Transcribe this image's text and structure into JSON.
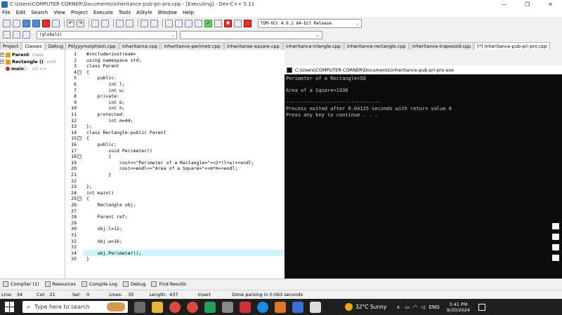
{
  "window": {
    "title": "C:\\Users\\COMPUTER CORNER\\Documents\\inheritance-pub-pri-pro.cpp - [Executing] - Dev-C++ 5.11",
    "controls": [
      "—",
      "❐",
      "✕"
    ]
  },
  "menu": [
    "File",
    "Edit",
    "Search",
    "View",
    "Project",
    "Execute",
    "Tools",
    "AStyle",
    "Window",
    "Help"
  ],
  "toolbar": {
    "compiler": "TDM-GCC 4.9.2 64-bit Release"
  },
  "scope_select": "(globals)",
  "left_panel": {
    "tabs": [
      "Project",
      "Classes",
      "Debug"
    ],
    "active_tab": "Classes",
    "tree": [
      {
        "name": "Parent",
        "suffix": ": class"
      },
      {
        "name": "Rectangle ()",
        "suffix": ": void"
      },
      {
        "name": "main",
        "suffix": "() : int <<"
      }
    ]
  },
  "editor_tabs": [
    "Polyyymorphism.cpp",
    "inheritance.cpp",
    "inheritance-perimetr.cpp",
    "inheritanse-square.cpp",
    "inheritance-triangle.cpp",
    "inheritance-rectangle.cpp",
    "inheritance-trapezoid.cpp",
    "[*] inheritance-pub-pri-pro.cpp"
  ],
  "active_editor_tab": "[*] inheritance-pub-pri-pro.cpp",
  "code_lines": [
    "#include<iostream>",
    "using namespace std;",
    "class Parent",
    "{",
    "    public:",
    "        int l;",
    "        int w;",
    "    private:",
    "        int b;",
    "        int h;",
    "    protected:",
    "        int m=44;",
    "};",
    "class Rectangle:public Parent",
    "{",
    "    public:",
    "        void Perimeter()",
    "        {",
    "            cout<<\"Perimeter of a Rectangle=\"<<2*(l+w)<<endl;",
    "            cout<<endl<<\"Area of a Square=\"<<m*m<<endl;",
    "        }",
    "",
    "};",
    "int main()",
    "{",
    "    Rectangle obj;",
    "",
    "    Parent ref;",
    "",
    "    obj.l=12;",
    "",
    "    obj.w=16;",
    "",
    "    obj.Perimeter();",
    "}"
  ],
  "highlight_line": 34,
  "console": {
    "title": "C:\\Users\\COMPUTER CORNER\\Documents\\inheritance-pub-pri-pro.exe",
    "lines": [
      "Perimeter of a Rectangle=56",
      "",
      "Area of a Square=1936",
      "",
      "--------------------------------",
      "Process exited after 0.04125 seconds with return value 0",
      "Press any key to continue . . ."
    ]
  },
  "bottom_tabs": [
    "Compiler (1)",
    "Resources",
    "Compile Log",
    "Debug",
    "Find Results"
  ],
  "status": {
    "line_label": "Line:",
    "line": "34",
    "col_label": "Col:",
    "col": "21",
    "sel_label": "Sel:",
    "sel": "0",
    "lines_label": "Lines:",
    "lines": "35",
    "length_label": "Length:",
    "length": "437",
    "mode": "Insert",
    "message": "Done parsing in 0.063 seconds"
  },
  "taskbar": {
    "search_placeholder": "Type here to search",
    "weather": "32°C  Sunny",
    "lang": "ENG",
    "time": "3:41 PM",
    "date": "9/30/2024"
  }
}
